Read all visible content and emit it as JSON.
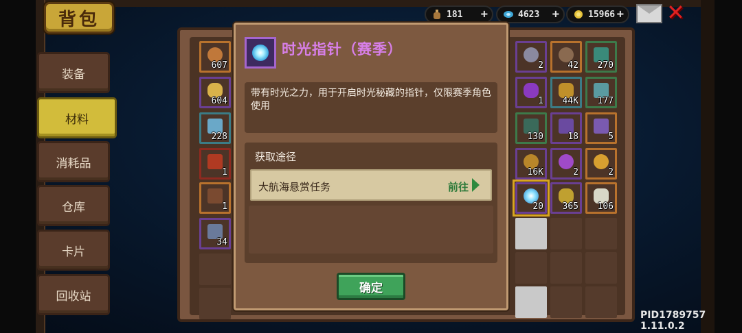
{
  "header": {
    "title": "背包",
    "currencies": [
      {
        "icon": "bottle-icon",
        "value": "181"
      },
      {
        "icon": "gem-icon",
        "value": "4623"
      },
      {
        "icon": "coin-icon",
        "value": "15966"
      }
    ],
    "plus": "+"
  },
  "nav": {
    "items": [
      {
        "label": "装备"
      },
      {
        "label": "材料"
      },
      {
        "label": "消耗品"
      },
      {
        "label": "仓库"
      },
      {
        "label": "卡片"
      },
      {
        "label": "回收站"
      }
    ],
    "active_index": 1
  },
  "inventory": {
    "left_counts": [
      "607",
      "604",
      "228",
      "1",
      "1",
      "34"
    ],
    "right_counts": [
      "2",
      "42",
      "270",
      "1",
      "44K",
      "177",
      "130",
      "18",
      "5",
      "16K",
      "2",
      "2",
      "20",
      "365",
      "106"
    ]
  },
  "modal": {
    "title": "时光指针（赛季）",
    "description": "带有时光之力，用于开启时光秘藏的指针，仅限赛季角色使用",
    "source_heading": "获取途径",
    "source_item": "大航海悬赏任务",
    "go_label": "前往",
    "confirm_label": "确定"
  },
  "footer": {
    "pid": "PID1789757 1.11.0.2"
  },
  "colors": {
    "accent_gold": "#d2bc3b",
    "modal_title": "#d77fe8",
    "confirm_green": "#3fa35a",
    "close_red": "#e02020"
  }
}
